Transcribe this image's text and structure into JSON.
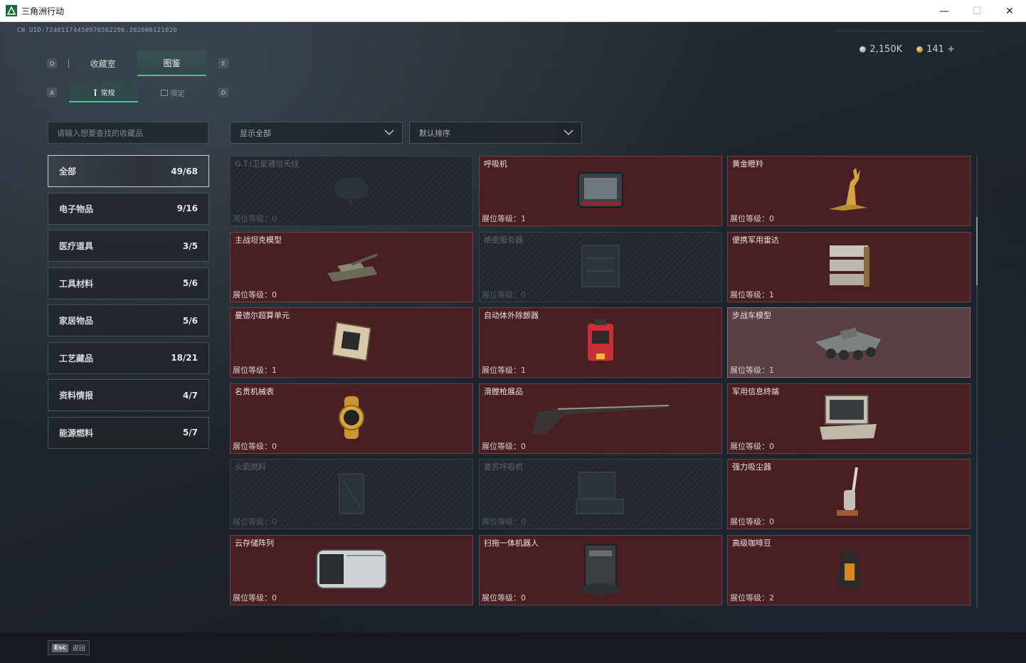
{
  "window": {
    "title": "三角洲行动",
    "minimize": "—",
    "maximize": "☐",
    "close": "✕"
  },
  "header": {
    "uid": "CN UID:72401174450976562296.202606121020",
    "currency": [
      {
        "icon": "silver-coin-icon",
        "value": "2,150K"
      },
      {
        "icon": "gold-coin-icon",
        "value": "141"
      }
    ],
    "add_label": "+"
  },
  "key_hints": {
    "left_tab": "Q",
    "right_tab": "E",
    "left_sub": "A",
    "right_sub": "D"
  },
  "tabs": [
    {
      "label": "收藏室",
      "active": false
    },
    {
      "label": "图鉴",
      "active": true
    }
  ],
  "sub_tabs": [
    {
      "label": "常规",
      "icon": "figure-icon",
      "active": true
    },
    {
      "label": "限定",
      "icon": "frame-icon",
      "active": false
    }
  ],
  "search": {
    "placeholder": "请输入想要查找的收藏品"
  },
  "filters": {
    "category_filter": "显示全部",
    "sort": "默认排序"
  },
  "categories": [
    {
      "label": "全部",
      "count": "49/68",
      "active": true
    },
    {
      "label": "电子物品",
      "count": "9/16",
      "active": false
    },
    {
      "label": "医疗道具",
      "count": "3/5",
      "active": false
    },
    {
      "label": "工具材料",
      "count": "5/6",
      "active": false
    },
    {
      "label": "家居物品",
      "count": "5/6",
      "active": false
    },
    {
      "label": "工艺藏品",
      "count": "18/21",
      "active": false
    },
    {
      "label": "资料情报",
      "count": "4/7",
      "active": false
    },
    {
      "label": "能源燃料",
      "count": "5/7",
      "active": false
    }
  ],
  "level_prefix": "展位等级：",
  "items": [
    {
      "name": "G.T.I卫星通信天线",
      "level": "0",
      "state": "locked",
      "icon": "satellite-antenna-icon"
    },
    {
      "name": "呼吸机",
      "level": "1",
      "state": "owned",
      "icon": "ventilator-icon"
    },
    {
      "name": "黄金瞪羚",
      "level": "0",
      "state": "owned",
      "icon": "golden-gazelle-icon"
    },
    {
      "name": "主战坦克模型",
      "level": "0",
      "state": "owned",
      "icon": "tank-model-icon"
    },
    {
      "name": "绝密服务器",
      "level": "0",
      "state": "locked",
      "icon": "server-icon"
    },
    {
      "name": "便携军用雷达",
      "level": "1",
      "state": "owned",
      "icon": "radar-icon"
    },
    {
      "name": "曼德尔超算单元",
      "level": "1",
      "state": "owned",
      "icon": "compute-unit-icon"
    },
    {
      "name": "自动体外除颤器",
      "level": "1",
      "state": "owned",
      "icon": "defibrillator-icon"
    },
    {
      "name": "步战车模型",
      "level": "1",
      "state": "highlight",
      "icon": "ifv-model-icon"
    },
    {
      "name": "名贵机械表",
      "level": "0",
      "state": "owned",
      "icon": "watch-icon"
    },
    {
      "name": "滑膛枪展品",
      "level": "0",
      "state": "owned",
      "icon": "musket-icon"
    },
    {
      "name": "军用信息终端",
      "level": "0",
      "state": "owned",
      "icon": "terminal-icon"
    },
    {
      "name": "火箭燃料",
      "level": "0",
      "state": "locked",
      "icon": "rocket-fuel-icon"
    },
    {
      "name": "复苏呼吸机",
      "level": "0",
      "state": "locked",
      "icon": "resuscitator-icon"
    },
    {
      "name": "强力吸尘器",
      "level": "0",
      "state": "owned",
      "icon": "vacuum-icon"
    },
    {
      "name": "云存储阵列",
      "level": "0",
      "state": "owned",
      "icon": "storage-array-icon"
    },
    {
      "name": "扫拖一体机器人",
      "level": "0",
      "state": "owned",
      "icon": "robot-vacuum-icon"
    },
    {
      "name": "高级咖啡豆",
      "level": "2",
      "state": "owned",
      "icon": "coffee-beans-icon"
    }
  ],
  "footer": {
    "esc_key": "Esc",
    "back_label": "返回"
  },
  "colors": {
    "accent": "#43c59a",
    "owned_card": "#4a1f24",
    "locked_card": "#22282e"
  }
}
